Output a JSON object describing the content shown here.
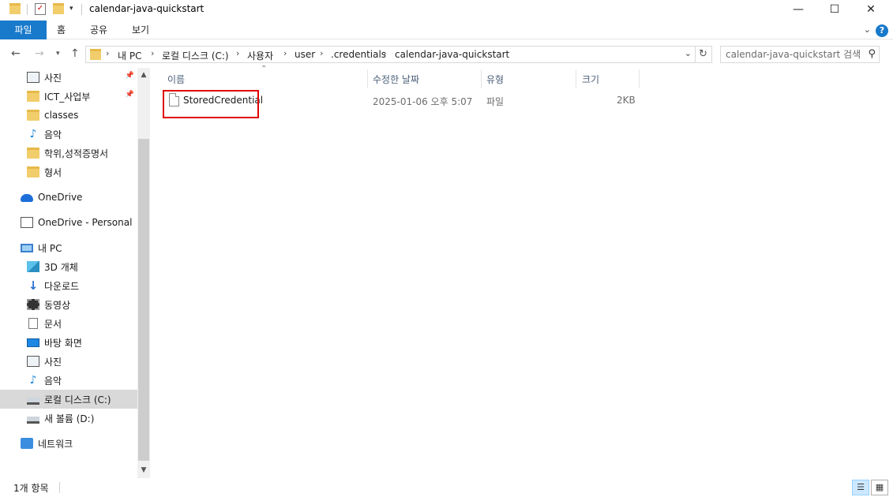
{
  "window": {
    "title": "calendar-java-quickstart",
    "minimize_glyph": "—",
    "maximize_glyph": "☐",
    "close_glyph": "✕"
  },
  "ribbon": {
    "tabs": [
      "파일",
      "홈",
      "공유",
      "보기"
    ],
    "help_glyph": "?"
  },
  "address": {
    "breadcrumbs": [
      "내 PC",
      "로컬 디스크 (C:)",
      "사용자",
      "user",
      ".credentials",
      "calendar-java-quickstart"
    ],
    "search_placeholder": "calendar-java-quickstart 검색"
  },
  "nav_pane": {
    "items": [
      {
        "label": "사진",
        "icon": "picture-icon",
        "pinned": true
      },
      {
        "label": "ICT_사업부",
        "icon": "folder-icon",
        "pinned": true
      },
      {
        "label": "classes",
        "icon": "folder-icon",
        "pinned": false
      },
      {
        "label": "음악",
        "icon": "music-icon",
        "pinned": false
      },
      {
        "label": "학위,성적증명서",
        "icon": "folder-icon",
        "pinned": false
      },
      {
        "label": "형서",
        "icon": "folder-icon",
        "pinned": false
      },
      {
        "label": "OneDrive",
        "icon": "onedrive-icon",
        "pinned": false
      },
      {
        "label": "OneDrive - Personal",
        "icon": "onedrive-personal-icon",
        "pinned": false
      },
      {
        "label": "내 PC",
        "icon": "this-pc-icon",
        "pinned": false
      },
      {
        "label": "3D 개체",
        "icon": "3d-objects-icon",
        "pinned": false
      },
      {
        "label": "다운로드",
        "icon": "download-icon",
        "pinned": false
      },
      {
        "label": "동영상",
        "icon": "video-icon",
        "pinned": false
      },
      {
        "label": "문서",
        "icon": "document-icon",
        "pinned": false
      },
      {
        "label": "바탕 화면",
        "icon": "desktop-icon",
        "pinned": false
      },
      {
        "label": "사진",
        "icon": "picture-icon",
        "pinned": false
      },
      {
        "label": "음악",
        "icon": "music-icon",
        "pinned": false
      },
      {
        "label": "로컬 디스크 (C:)",
        "icon": "local-disk-icon",
        "pinned": false,
        "selected": true
      },
      {
        "label": "새 볼륨 (D:)",
        "icon": "drive-icon",
        "pinned": false
      },
      {
        "label": "네트워크",
        "icon": "network-icon",
        "pinned": false
      }
    ]
  },
  "columns": {
    "name": "이름",
    "modified": "수정한 날짜",
    "type": "유형",
    "size": "크기"
  },
  "files": [
    {
      "name": "StoredCredential",
      "modified": "2025-01-06 오후 5:07",
      "type": "파일",
      "size": "2KB"
    }
  ],
  "status_bar": {
    "item_count": "1개 항목"
  },
  "colors": {
    "accent": "#1979ca",
    "highlight_box": "#e00000",
    "selected_nav": "#d9d9d9"
  }
}
